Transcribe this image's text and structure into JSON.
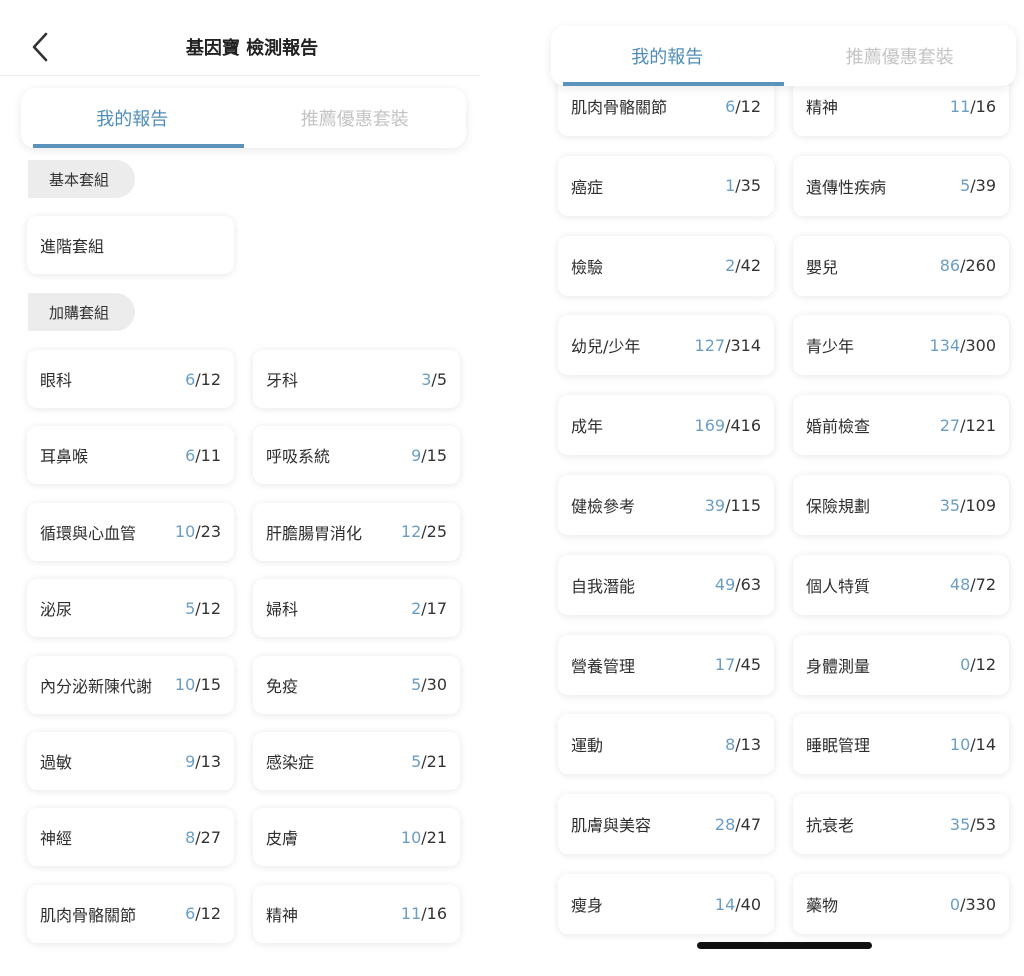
{
  "header": {
    "title": "基因寶 檢測報告",
    "back_icon": "chevron-left-icon"
  },
  "tabs": [
    {
      "label": "我的報告",
      "active": true
    },
    {
      "label": "推薦優惠套裝",
      "active": false
    }
  ],
  "colors": {
    "accent": "#5b93bd",
    "progress_text": "#6a9ec6",
    "tab_inactive": "#c4c4c4",
    "pill_bg": "#ececec"
  },
  "left": {
    "basic_section_label": "基本套組",
    "basic_items": [
      {
        "name": "進階套組"
      }
    ],
    "addon_section_label": "加購套組",
    "addon_items": [
      {
        "name": "眼科",
        "done": "6",
        "total": "12"
      },
      {
        "name": "牙科",
        "done": "3",
        "total": "5"
      },
      {
        "name": "耳鼻喉",
        "done": "6",
        "total": "11"
      },
      {
        "name": "呼吸系統",
        "done": "9",
        "total": "15"
      },
      {
        "name": "循環與心血管",
        "done": "10",
        "total": "23"
      },
      {
        "name": "肝膽腸胃消化",
        "done": "12",
        "total": "25"
      },
      {
        "name": "泌尿",
        "done": "5",
        "total": "12"
      },
      {
        "name": "婦科",
        "done": "2",
        "total": "17"
      },
      {
        "name": "內分泌新陳代謝",
        "done": "10",
        "total": "15"
      },
      {
        "name": "免疫",
        "done": "5",
        "total": "30"
      },
      {
        "name": "過敏",
        "done": "9",
        "total": "13"
      },
      {
        "name": "感染症",
        "done": "5",
        "total": "21"
      },
      {
        "name": "神經",
        "done": "8",
        "total": "27"
      },
      {
        "name": "皮膚",
        "done": "10",
        "total": "21"
      },
      {
        "name": "肌肉骨骼關節",
        "done": "6",
        "total": "12"
      },
      {
        "name": "精神",
        "done": "11",
        "total": "16"
      }
    ]
  },
  "right": {
    "items": [
      {
        "name": "肌肉骨骼關節",
        "done": "6",
        "total": "12"
      },
      {
        "name": "精神",
        "done": "11",
        "total": "16"
      },
      {
        "name": "癌症",
        "done": "1",
        "total": "35"
      },
      {
        "name": "遺傳性疾病",
        "done": "5",
        "total": "39"
      },
      {
        "name": "檢驗",
        "done": "2",
        "total": "42"
      },
      {
        "name": "嬰兒",
        "done": "86",
        "total": "260"
      },
      {
        "name": "幼兒/少年",
        "done": "127",
        "total": "314"
      },
      {
        "name": "青少年",
        "done": "134",
        "total": "300"
      },
      {
        "name": "成年",
        "done": "169",
        "total": "416"
      },
      {
        "name": "婚前檢查",
        "done": "27",
        "total": "121"
      },
      {
        "name": "健檢參考",
        "done": "39",
        "total": "115"
      },
      {
        "name": "保險規劃",
        "done": "35",
        "total": "109"
      },
      {
        "name": "自我潛能",
        "done": "49",
        "total": "63"
      },
      {
        "name": "個人特質",
        "done": "48",
        "total": "72"
      },
      {
        "name": "營養管理",
        "done": "17",
        "total": "45"
      },
      {
        "name": "身體測量",
        "done": "0",
        "total": "12"
      },
      {
        "name": "運動",
        "done": "8",
        "total": "13"
      },
      {
        "name": "睡眠管理",
        "done": "10",
        "total": "14"
      },
      {
        "name": "肌膚與美容",
        "done": "28",
        "total": "47"
      },
      {
        "name": "抗衰老",
        "done": "35",
        "total": "53"
      },
      {
        "name": "瘦身",
        "done": "14",
        "total": "40"
      },
      {
        "name": "藥物",
        "done": "0",
        "total": "330"
      }
    ]
  }
}
